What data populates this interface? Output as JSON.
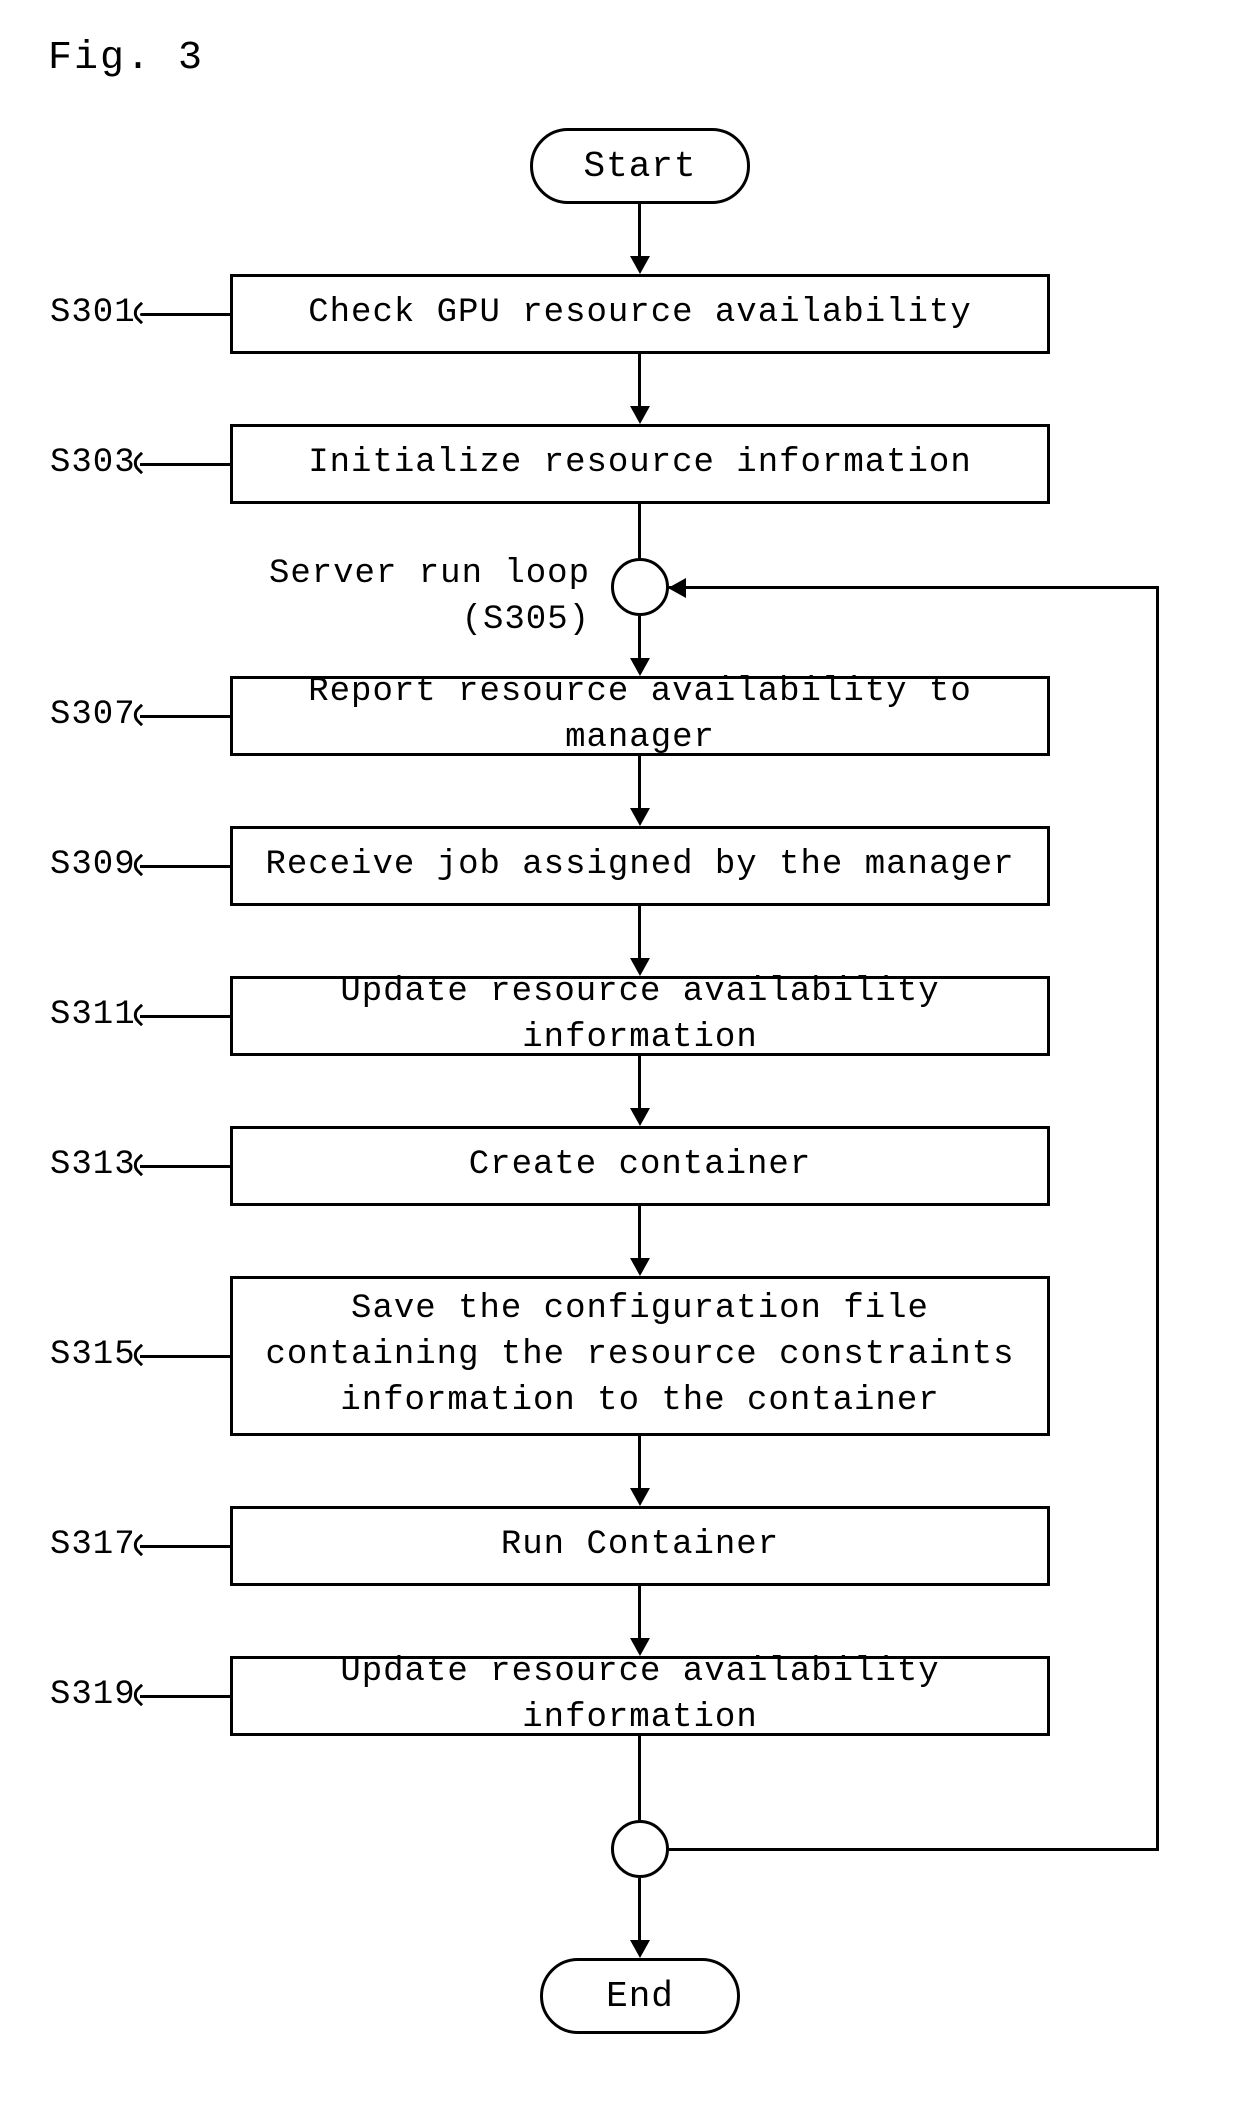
{
  "figure_label": "Fig. 3",
  "terminals": {
    "start": "Start",
    "end": "End"
  },
  "loop": {
    "label_line1": "Server run loop",
    "label_line2": "(S305)"
  },
  "steps": {
    "s301": {
      "tag": "S301",
      "text": "Check GPU resource availability"
    },
    "s303": {
      "tag": "S303",
      "text": "Initialize resource information"
    },
    "s307": {
      "tag": "S307",
      "text": "Report resource availability to manager"
    },
    "s309": {
      "tag": "S309",
      "text": "Receive job assigned by the manager"
    },
    "s311": {
      "tag": "S311",
      "text": "Update resource availability information"
    },
    "s313": {
      "tag": "S313",
      "text": "Create container"
    },
    "s315": {
      "tag": "S315",
      "text": "Save the configuration file\ncontaining the resource constraints\ninformation to the container"
    },
    "s317": {
      "tag": "S317",
      "text": "Run Container"
    },
    "s319": {
      "tag": "S319",
      "text": "Update resource availability information"
    }
  }
}
